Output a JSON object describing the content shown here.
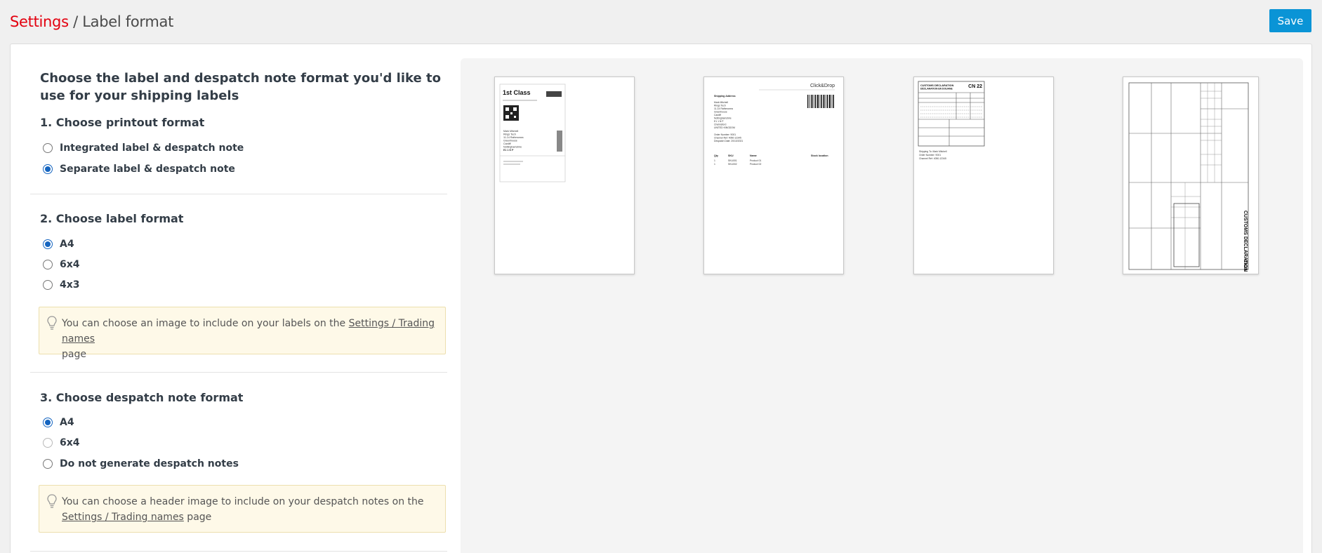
{
  "header": {
    "breadcrumb_root": "Settings",
    "breadcrumb_sep": " / ",
    "breadcrumb_current": "Label format",
    "save_label": "Save"
  },
  "intro": "Choose the label and despatch note format you'd like to use for your shipping labels",
  "section1": {
    "title": "1. Choose printout format",
    "options": [
      "Integrated label & despatch note",
      "Separate label & despatch note"
    ],
    "selected": "Separate label & despatch note"
  },
  "section2": {
    "title": "2. Choose label format",
    "options": [
      "A4",
      "6x4",
      "4x3"
    ],
    "selected": "A4",
    "tip_text": "You can choose an image to include on your labels on the ",
    "tip_link": "Settings / Trading names",
    "tip_after": "page"
  },
  "section3": {
    "title": "3. Choose despatch note format",
    "options": [
      "A4",
      "6x4",
      "Do not generate despatch notes"
    ],
    "selected": "A4",
    "tip_text": "You can choose a header image to include on your despatch notes on the ",
    "tip_link": "Settings / Trading names",
    "tip_after": " page"
  },
  "previews": {
    "label": {
      "service": "1st Class",
      "address_lines": [
        "Mark Mitchell",
        "Rings Tech",
        "11-14 Rathmonea",
        "Greenhouse",
        "Cardiff",
        "Nottinghamshire",
        "E1 1 N P"
      ]
    },
    "despatch": {
      "brand": "Click&Drop",
      "heading": "Shipping Address",
      "address_lines": [
        "Mark Mitchell",
        "Rings Tech",
        "11-14 Rathmonea",
        "Greenhouse",
        "Cardiff",
        "Nottinghamshire",
        "E1 1 N P",
        "Chelmsford",
        "UNITED KINGDOM"
      ],
      "order_lines": [
        "Order Number:  9001",
        "Channel Ref:  4050-12345",
        "Despatch Date:  20/10/2021"
      ],
      "table_headers": [
        "Qty",
        "SKU",
        "Name",
        "Stock location"
      ],
      "rows": [
        [
          "1",
          "SKU001",
          "Product 01"
        ],
        [
          "1",
          "SKU002",
          "Product 02"
        ]
      ]
    },
    "cn22": {
      "title": "CUSTOMS DECLARATION",
      "subtitle": "DÉCLARATION EN DOUANE",
      "code": "CN 22",
      "info_lines": [
        "Shipping To:  Mark Mitchell",
        "Order Number:  9001",
        "Channel Ref:  4050-12345"
      ]
    },
    "cn23": {
      "title": "CUSTOMS DECLARATION",
      "code": "CN23"
    }
  }
}
